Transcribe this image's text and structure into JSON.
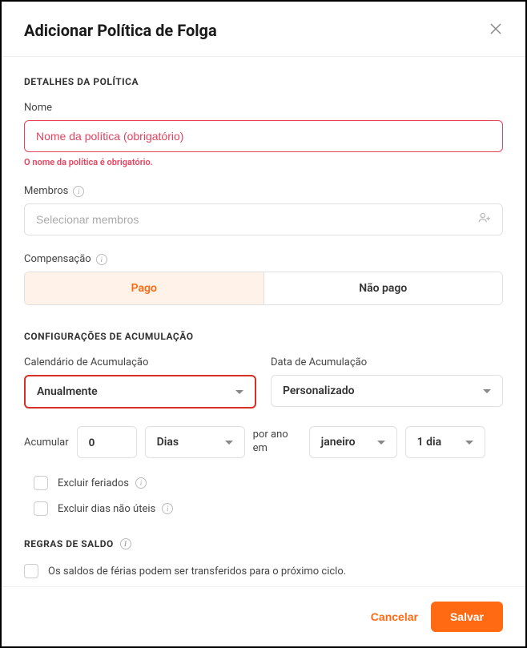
{
  "header": {
    "title": "Adicionar Política de Folga"
  },
  "sections": {
    "details": {
      "title": "DETALHES DA POLÍTICA",
      "name": {
        "label": "Nome",
        "placeholder": "Nome da política (obrigatório)",
        "error": "O nome da política é obrigatório."
      },
      "members": {
        "label": "Membros",
        "placeholder": "Selecionar membros"
      },
      "compensation": {
        "label": "Compensação",
        "paid": "Pago",
        "unpaid": "Não pago"
      }
    },
    "accrual": {
      "title": "CONFIGURAÇÕES DE ACUMULAÇÃO",
      "schedule": {
        "label": "Calendário de Acumulação",
        "value": "Anualmente"
      },
      "date": {
        "label": "Data de Acumulação",
        "value": "Personalizado"
      },
      "accrue": {
        "label": "Acumular",
        "amount": "0",
        "unit": "Dias",
        "per_year": "por ano em",
        "month": "janeiro",
        "day": "1 dia"
      },
      "exclude_holidays": "Excluir feriados",
      "exclude_nonwork": "Excluir dias não úteis"
    },
    "balance": {
      "title": "REGRAS DE SALDO",
      "carryover": "Os saldos de férias podem ser transferidos para o próximo ciclo."
    }
  },
  "footer": {
    "cancel": "Cancelar",
    "save": "Salvar"
  }
}
